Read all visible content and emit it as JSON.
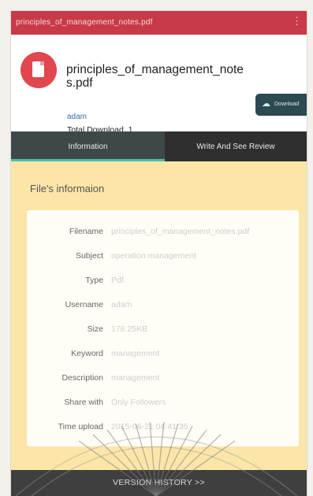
{
  "titlebar": {
    "title": "principles_of_management_notes.pdf",
    "menu": "⋮"
  },
  "header": {
    "filename": "principles_of_management_notes.pdf",
    "uploader": "adam",
    "total_download_label": "Total Download",
    "total_download_value": "1",
    "rating_hearts": "♥♥♥♥",
    "download_button": "Download",
    "download_icon": "cloud-download-icon"
  },
  "tabs": [
    {
      "label": "Information",
      "active": true
    },
    {
      "label": "Write And See Review",
      "active": false
    }
  ],
  "info": {
    "title": "File's informaion",
    "rows": [
      {
        "label": "Filename",
        "value": "principles_of_management_notes.pdf"
      },
      {
        "label": "Subject",
        "value": "operation management"
      },
      {
        "label": "Type",
        "value": "Pdf"
      },
      {
        "label": "Username",
        "value": "adam"
      },
      {
        "label": "Size",
        "value": "178.25KB"
      },
      {
        "label": "Keyword",
        "value": "management"
      },
      {
        "label": "Description",
        "value": "management"
      },
      {
        "label": "Share with",
        "value": "Only Followers"
      },
      {
        "label": "Time upload",
        "value": "2015-06-21 04:41:35"
      }
    ]
  },
  "footer": {
    "label": "VERSION HISTORY >>"
  },
  "colors": {
    "titlebar": "#c83a48",
    "icon": "#e0474f",
    "download_button": "#2c4a52",
    "tab_indicator": "#49bfae",
    "content_bg": "#fbe6a8"
  }
}
